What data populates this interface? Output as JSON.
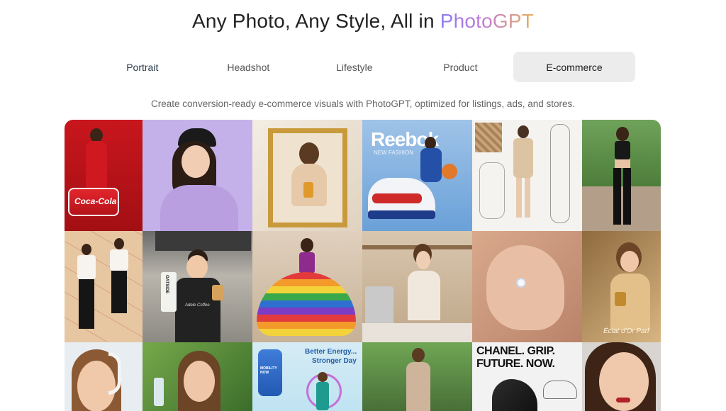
{
  "header": {
    "title_prefix": "Any Photo, Any Style, All in ",
    "title_brand": "PhotoGPT"
  },
  "tabs": [
    {
      "label": "Portrait",
      "active": false
    },
    {
      "label": "Headshot",
      "active": false
    },
    {
      "label": "Lifestyle",
      "active": false
    },
    {
      "label": "Product",
      "active": false
    },
    {
      "label": "E-commerce",
      "active": true
    }
  ],
  "subtitle": "Create conversion-ready e-commerce visuals with PhotoGPT, optimized for listings, ads, and stores.",
  "gallery": {
    "tile_texts": {
      "reebok": "Reebok",
      "reebok_sub": "NEW FASHION",
      "oatside": "OATSIDE",
      "apron": "Adele Coffee",
      "perfume": "Éclat d'Or Parf",
      "energy_line1": "Better Energy...",
      "energy_line2": "Stronger Day",
      "bottle": "MOBILITY NOW",
      "chanel_line1": "CHANEL. GRIP.",
      "chanel_line2": "FUTURE. NOW.",
      "cola": "Coca-Cola"
    }
  }
}
